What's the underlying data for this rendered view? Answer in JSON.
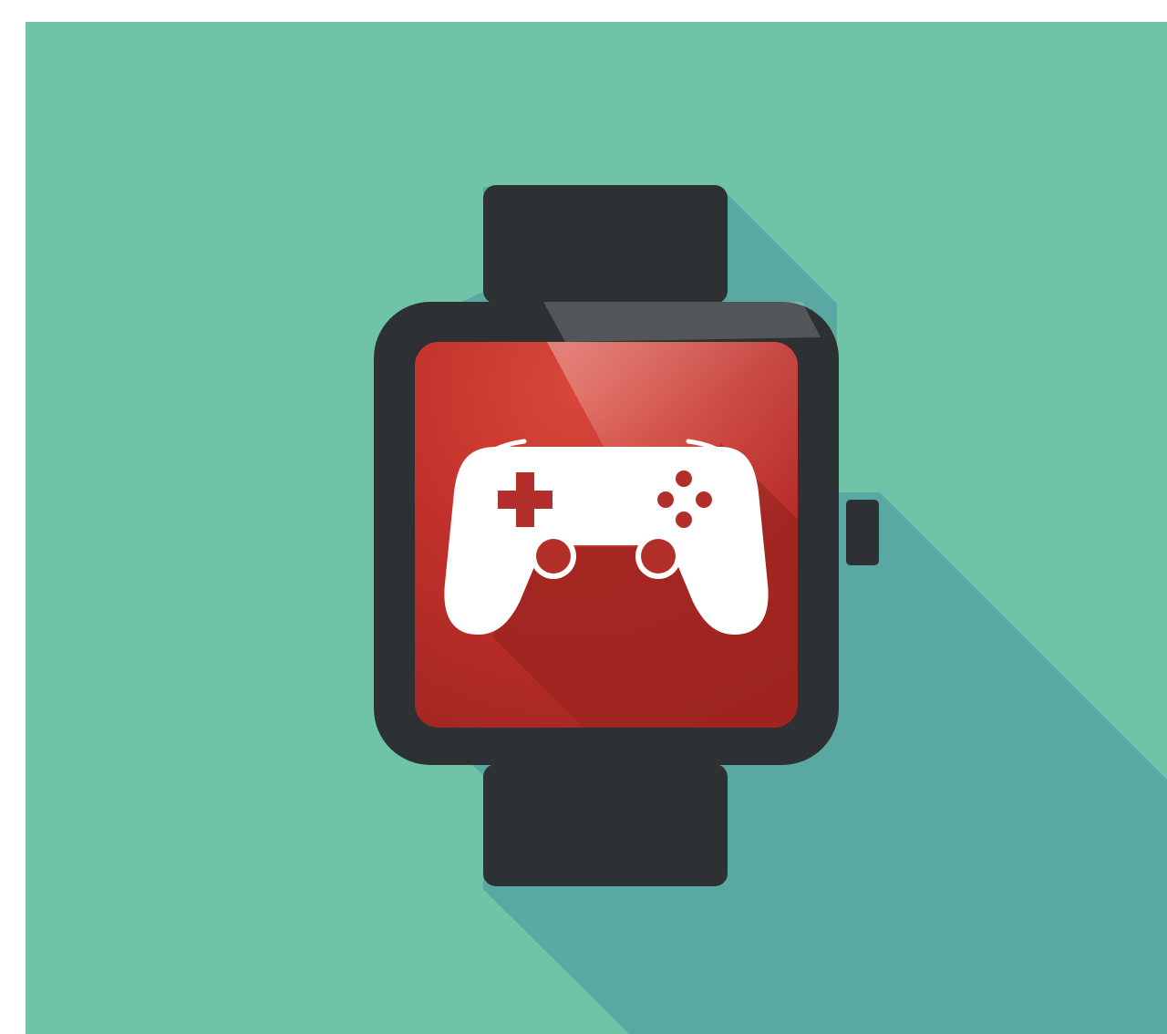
{
  "scene": {
    "subject": "smartwatch-icon",
    "screen_icon": "gamepad-icon",
    "colors": {
      "page_border": "#ffffff",
      "background": "#6fc4a8",
      "long_shadow": "#5aa8a2",
      "watch_body": "#2d3134",
      "watch_strap": "#2d3134",
      "screen_red": "#c0302a",
      "screen_red_dark": "#a52722",
      "screen_shadow": "#9d2420",
      "controller": "#ffffff",
      "controller_buttons": "#b3302a"
    }
  }
}
